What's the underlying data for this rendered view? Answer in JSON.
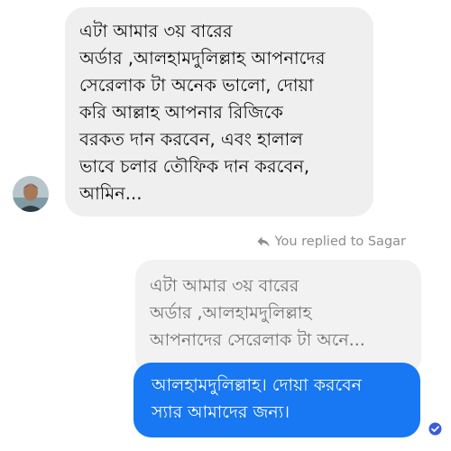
{
  "incoming_message": {
    "lines": [
      "এটা আমার ৩য় বারের",
      "অর্ডার ,আলহামদুলিল্লাহ আপনাদের",
      "সেরেলাক টা অনেক ভালো, দোয়া",
      "করি আল্লাহ আপনার রিজিকে",
      "বরকত দান করবেন, এবং হালাল",
      "ভাবে চলার তৌফিক দান করবেন,",
      "আমিন..."
    ]
  },
  "reply_meta": {
    "text": "You replied to Sagar",
    "icon": "reply-arrow-icon"
  },
  "quoted_message": {
    "lines": [
      "এটা আমার ৩য় বারের",
      "অর্ডার ,আলহামদুলিল্লাহ",
      "আপনাদের সেরেলাক টা অনে..."
    ]
  },
  "outgoing_message": {
    "lines": [
      "আলহামদুলিল্লাহ। দোয়া করবেন",
      "স্যার আমাদের জন্য।"
    ]
  },
  "colors": {
    "outgoing_bubble": "#1877f2",
    "incoming_bubble": "#efefef",
    "quoted_bubble": "#f2f2f2",
    "meta_text": "#8a8d91"
  }
}
